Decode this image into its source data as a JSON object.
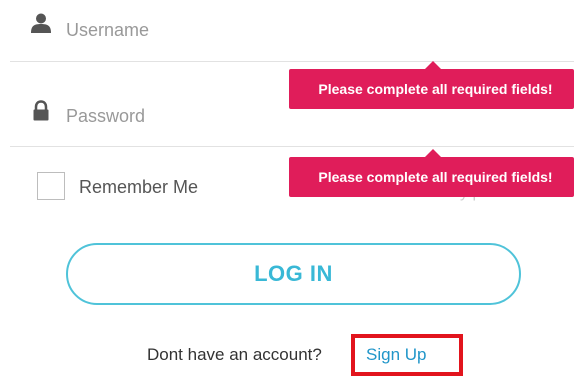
{
  "form": {
    "username": {
      "icon": "user-icon",
      "placeholder": "Username",
      "value": ""
    },
    "password": {
      "icon": "lock-icon",
      "placeholder": "Password",
      "value": ""
    },
    "remember_me_label": "Remember Me",
    "hidden_link_fragment": "y   p",
    "login_label": "LOG IN"
  },
  "validation": {
    "username_message": "Please complete all required fields!",
    "password_message": "Please complete all required fields!"
  },
  "footer": {
    "prompt": "Dont have an account?",
    "signup_label": "Sign Up"
  },
  "colors": {
    "tooltip_bg": "#e01d5a",
    "login_accent": "#39b8d6",
    "link": "#2196c9",
    "highlight_box": "#e2141d"
  }
}
